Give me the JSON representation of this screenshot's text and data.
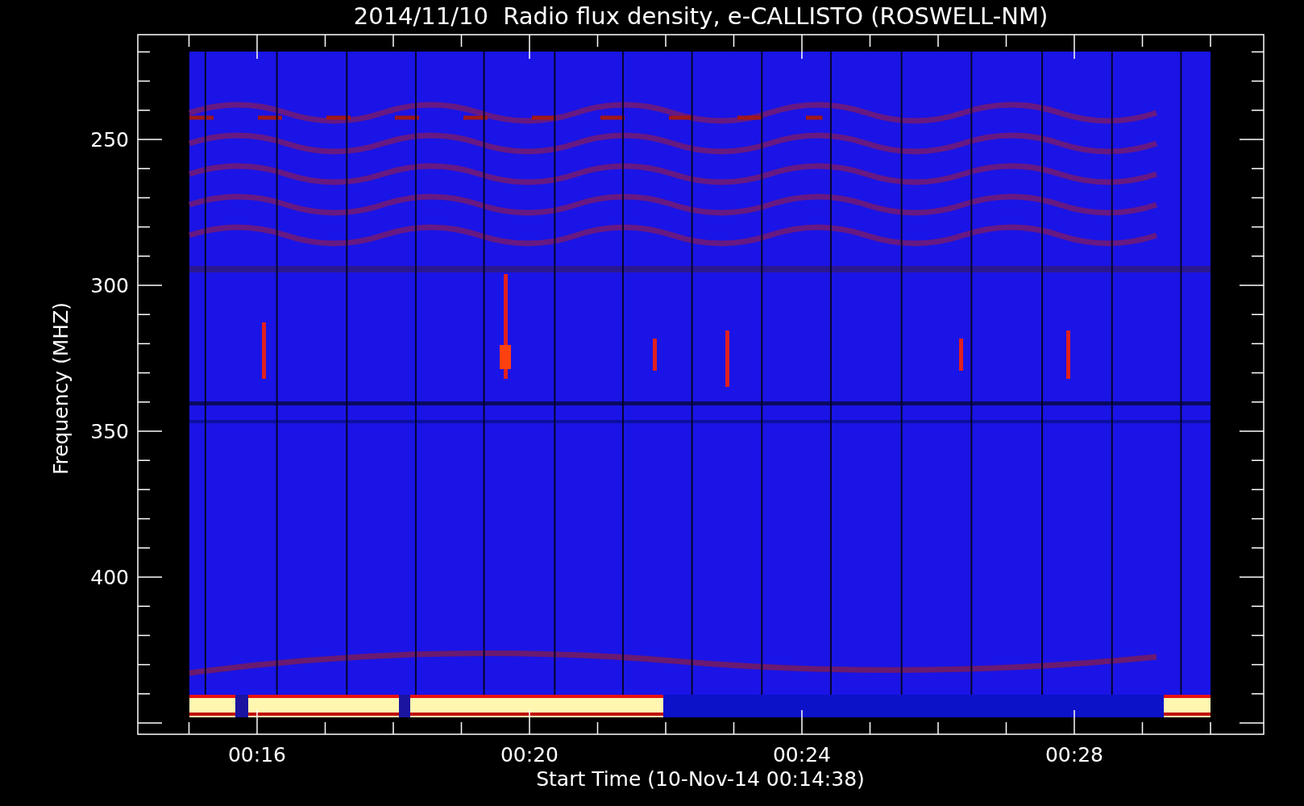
{
  "title": "2014/11/10  Radio flux density, e-CALLISTO (ROSWELL-NM)",
  "y_axis": {
    "label": "Frequency (MHZ)",
    "ticks": [
      "250",
      "300",
      "350",
      "400"
    ]
  },
  "x_axis": {
    "label": "Start Time (10-Nov-14 00:14:38)",
    "ticks": [
      "00:16",
      "00:20",
      "00:24",
      "00:28"
    ]
  }
}
